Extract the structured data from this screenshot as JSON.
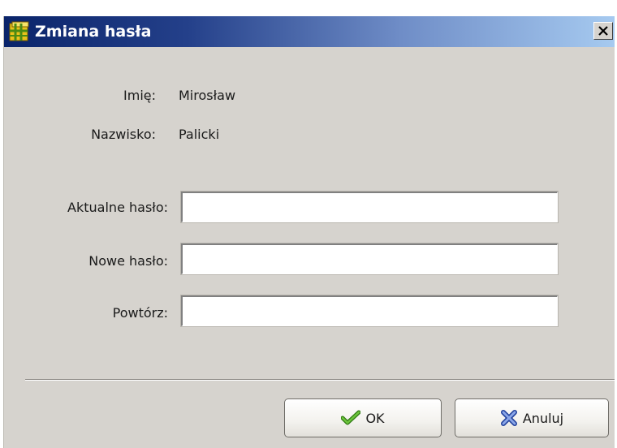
{
  "window": {
    "title": "Zmiana hasła",
    "close_label": "Close"
  },
  "info": {
    "first_name_label": "Imię:",
    "first_name_value": "Mirosław",
    "last_name_label": "Nazwisko:",
    "last_name_value": "Palicki"
  },
  "form": {
    "current_password_label": "Aktualne hasło:",
    "current_password_value": "",
    "new_password_label": "Nowe hasło:",
    "new_password_value": "",
    "repeat_label": "Powtórz:",
    "repeat_value": ""
  },
  "buttons": {
    "ok_label": "OK",
    "ok_icon": "check-icon",
    "cancel_label": "Anuluj",
    "cancel_icon": "cross-icon"
  },
  "colors": {
    "titlebar_start": "#0a246a",
    "titlebar_end": "#a6caf0",
    "dialog_bg": "#d6d3ce",
    "ok_icon": "#3c9a1c",
    "cancel_icon": "#3b5cb8"
  }
}
